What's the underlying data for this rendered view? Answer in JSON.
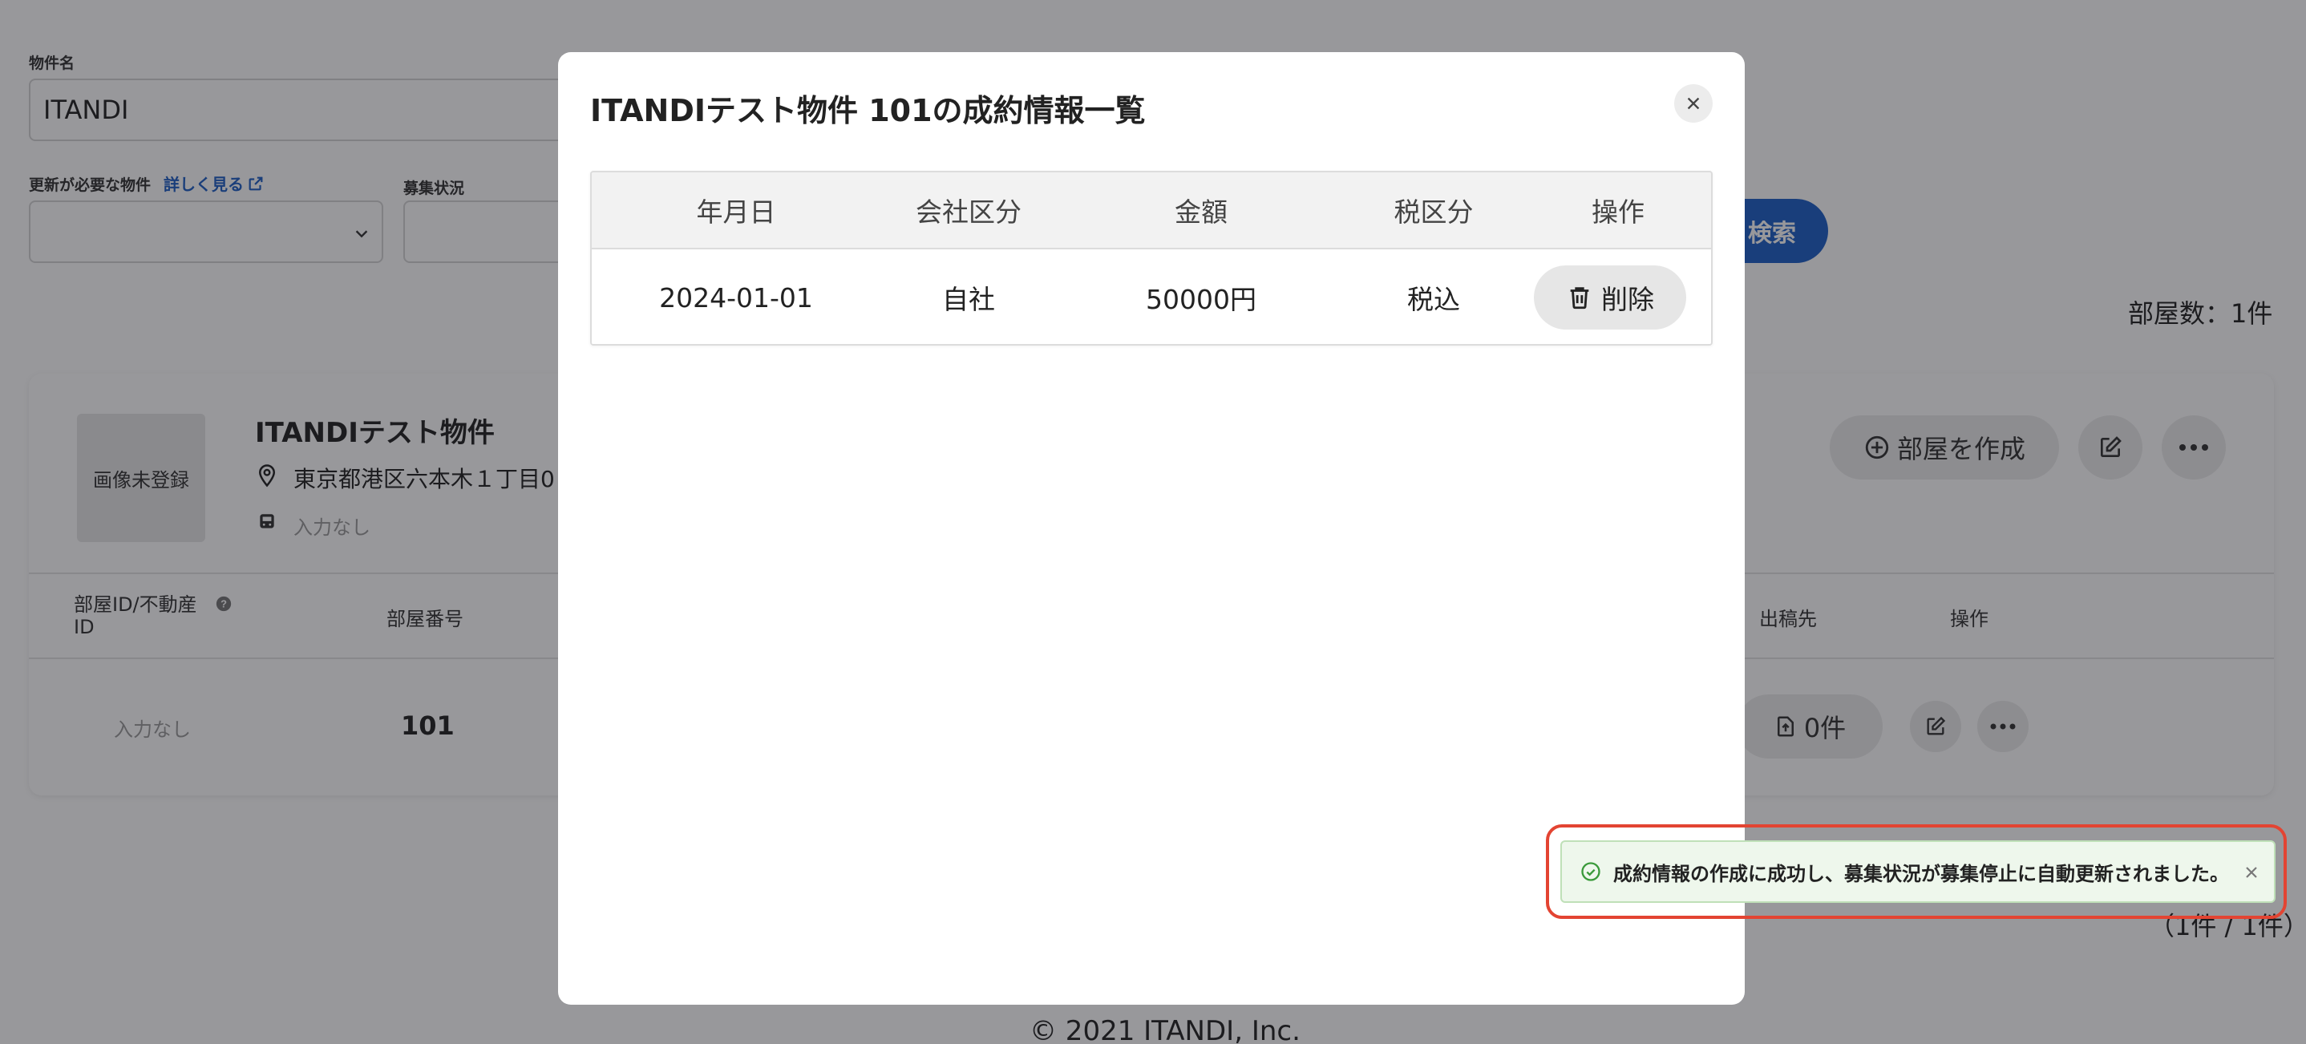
{
  "search_form": {
    "property_name_label": "物件名",
    "property_name_value": "ITANDI",
    "needs_update_label": "更新が必要な物件",
    "details_link": "詳しく見る",
    "recruit_status_label": "募集状況",
    "search_button": "検索"
  },
  "room_count_text": "部屋数：1件",
  "property": {
    "image_placeholder": "画像未登録",
    "name": "ITANDIテスト物件",
    "address": "東京都港区六本木１丁目0",
    "station": "入力なし",
    "create_room_button": "部屋を作成"
  },
  "rooms_table": {
    "headers": {
      "room_id": "部屋ID/不動産ID",
      "room_number": "部屋番号",
      "publish_to": "出稿先",
      "actions": "操作"
    },
    "rows": [
      {
        "room_id": "入力なし",
        "room_number": "101",
        "publish_count": "0件"
      }
    ]
  },
  "pagination_text": "（1件 / 1件）",
  "footer": {
    "copyright": "© 2021 ITANDI, Inc."
  },
  "modal": {
    "title": "ITANDIテスト物件 101の成約情報一覧",
    "columns": [
      "年月日",
      "会社区分",
      "金額",
      "税区分",
      "操作"
    ],
    "rows": [
      {
        "date": "2024-01-01",
        "company_type": "自社",
        "amount": "50000円",
        "tax_type": "税込",
        "delete_label": "削除"
      }
    ]
  },
  "toast": {
    "message": "成約情報の作成に成功し、募集状況が募集停止に自動更新されました。",
    "highlight_color": "#e34432"
  },
  "colors": {
    "primary": "#1d5fc7",
    "success_bg": "#eef7ec",
    "success_icon": "#3a9a3a"
  }
}
